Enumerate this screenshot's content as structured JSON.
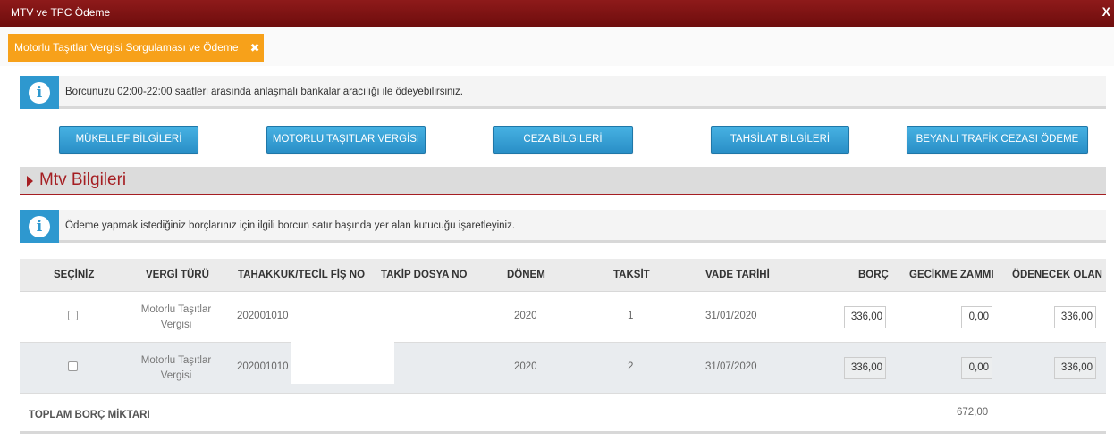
{
  "window": {
    "title": "MTV ve TPC Ödeme",
    "close": "X"
  },
  "tab": {
    "label": "Motorlu Taşıtlar Vergisi Sorgulaması ve Ödeme",
    "close": "✖"
  },
  "info1": {
    "icon": "info-icon",
    "text": "Borcunuzu 02:00-22:00 saatleri arasında anlaşmalı bankalar aracılığı ile ödeyebilirsiniz."
  },
  "buttons": [
    "MÜKELLEF BİLGİLERİ",
    "MOTORLU TAŞITLAR VERGİSİ",
    "CEZA BİLGİLERİ",
    "TAHSİLAT BİLGİLERİ",
    "BEYANLI TRAFİK CEZASI ÖDEME"
  ],
  "section": {
    "title": "Mtv Bilgileri"
  },
  "info2": {
    "icon": "info-icon",
    "text": "Ödeme yapmak istediğiniz borçlarınız için ilgili borcun satır başında yer alan kutucuğu işaretleyiniz."
  },
  "table": {
    "headers": [
      "SEÇİNİZ",
      "VERGİ TÜRÜ",
      "TAHAKKUK/TECİL FİŞ NO",
      "TAKİP DOSYA NO",
      "DÖNEM",
      "TAKSİT",
      "VADE TARİHİ",
      "BORÇ",
      "GECİKME ZAMMI",
      "ÖDENECEK OLAN"
    ],
    "rows": [
      {
        "vergi_turu_1": "Motorlu Taşıtlar",
        "vergi_turu_2": "Vergisi",
        "fis_no": "202001010",
        "donem": "2020",
        "taksit": "1",
        "vade": "31/01/2020",
        "borc": "336,00",
        "gecikme": "0,00",
        "odenecek": "336,00"
      },
      {
        "vergi_turu_1": "Motorlu Taşıtlar",
        "vergi_turu_2": "Vergisi",
        "fis_no": "202001010",
        "donem": "2020",
        "taksit": "2",
        "vade": "31/07/2020",
        "borc": "336,00",
        "gecikme": "0,00",
        "odenecek": "336,00"
      }
    ],
    "total_label": "TOPLAM BORÇ MİKTARI",
    "total_value": "672,00"
  },
  "colors": {
    "titlebar": "#7a1010",
    "tab": "#f7a11a",
    "button": "#2e98cf",
    "section_accent": "#a51e22",
    "info": "#2e98cf"
  }
}
